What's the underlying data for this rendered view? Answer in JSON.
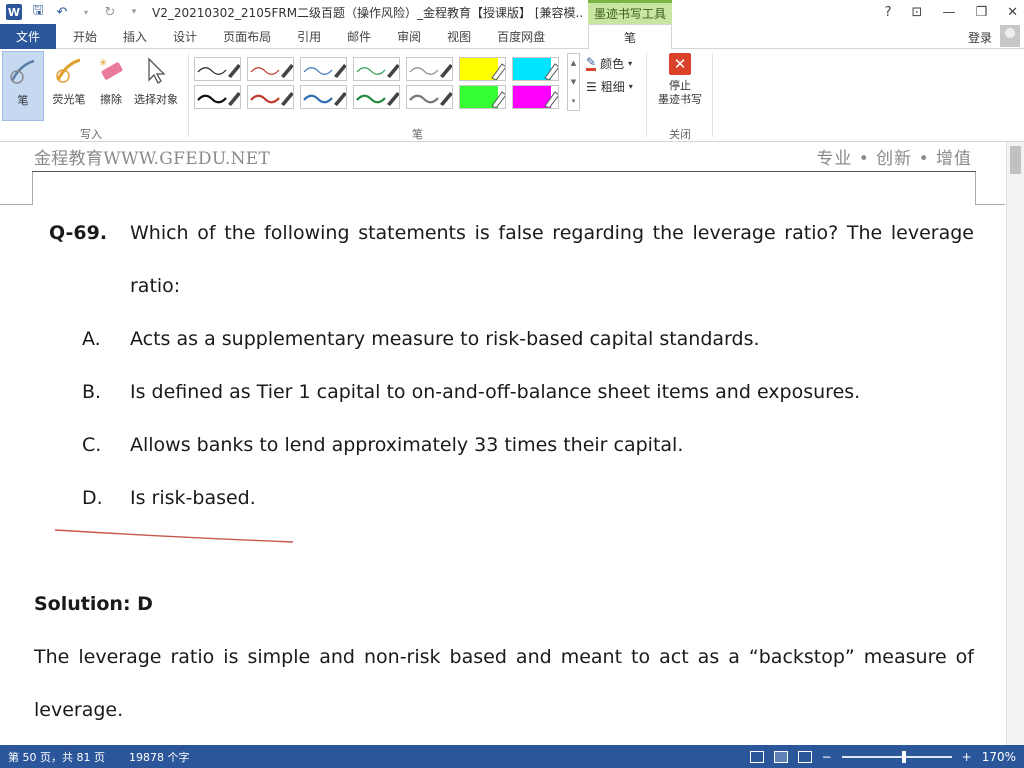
{
  "titlebar": {
    "doc_title": "V2_20210302_2105FRM二级百题（操作风险）_金程教育【授课版】 [兼容模...",
    "context_tab_title": "墨迹书写工具",
    "help": "?",
    "restore_ribbon": "⊡",
    "minimize": "—",
    "maximize": "❐",
    "close": "✕"
  },
  "tabs": {
    "file": "文件",
    "items": [
      "开始",
      "插入",
      "设计",
      "页面布局",
      "引用",
      "邮件",
      "审阅",
      "视图",
      "百度网盘"
    ],
    "active": "笔",
    "login": "登录"
  },
  "ribbon": {
    "write_group": {
      "label": "写入",
      "pen": "笔",
      "highlighter": "荧光笔",
      "eraser": "擦除",
      "select_objects": "选择对象"
    },
    "pens_group": {
      "label": "笔",
      "color": "颜色",
      "thickness": "粗细"
    },
    "close_group": {
      "label": "关闭",
      "stop_inking": "停止\n墨迹书写"
    }
  },
  "document": {
    "header_left": "金程教育WWW.GFEDU.NET",
    "header_right": "专业 • 创新 • 增值",
    "question_number": "Q-69.",
    "question_line1": "Which of the following statements is false regarding the leverage ratio? The leverage",
    "question_line2": "ratio:",
    "options": [
      {
        "letter": "A.",
        "text": "Acts as a supplementary measure to risk-based capital standards."
      },
      {
        "letter": "B.",
        "text": "Is defined as Tier 1 capital to on-and-off-balance sheet items and exposures."
      },
      {
        "letter": "C.",
        "text": "Allows banks to lend approximately 33 times their capital."
      },
      {
        "letter": "D.",
        "text": "Is risk-based."
      }
    ],
    "solution_label": "Solution: D",
    "solution_line1": "The leverage ratio is simple and non-risk based and meant to act as a “backstop” measure of",
    "solution_line2": "leverage."
  },
  "statusbar": {
    "page": "第 50 页，共 81 页",
    "word_count": "19878 个字",
    "zoom_out": "−",
    "zoom_in": "+",
    "zoom": "170%"
  },
  "colors": {
    "accent": "#2b579a",
    "context_tab": "#c8e6a0",
    "ink_red": "#c0392b"
  }
}
